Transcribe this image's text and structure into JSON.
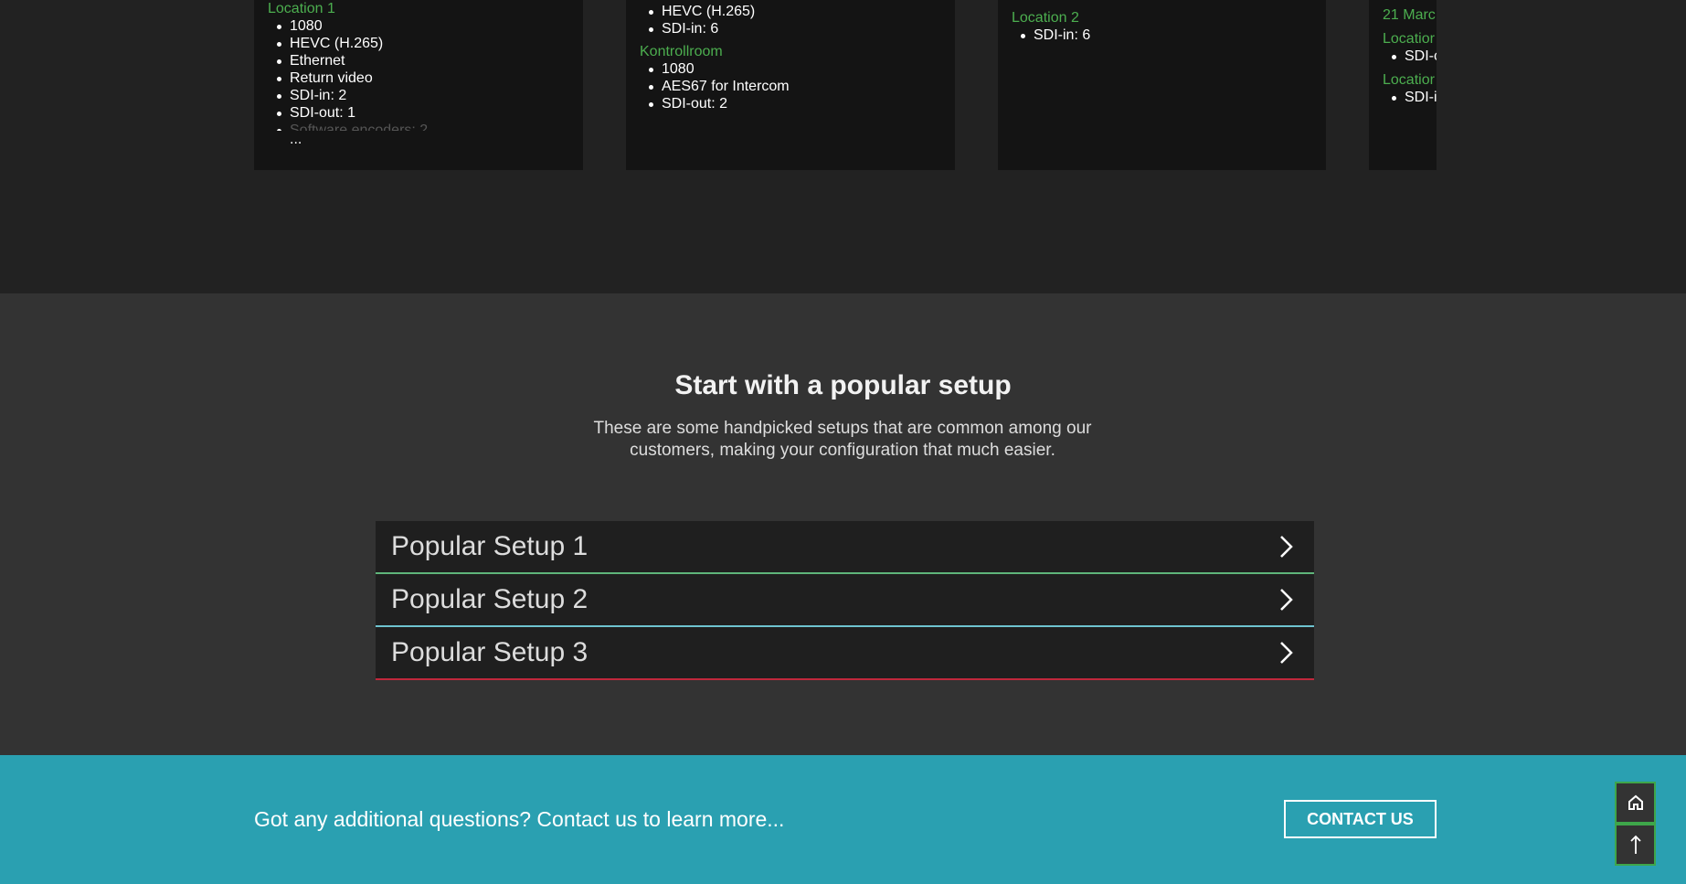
{
  "cards": [
    {
      "groups": [
        {
          "title": "Location 1",
          "items": [
            "1080",
            "HEVC (H.265)",
            "Ethernet",
            "Return video",
            "SDI-in: 2",
            "SDI-out: 1"
          ]
        }
      ],
      "faded": "Software encoders: 2",
      "more": "..."
    },
    {
      "groups": [
        {
          "title": "",
          "items": [
            "HEVC (H.265)",
            "SDI-in: 6"
          ]
        },
        {
          "title": "Kontrollroom",
          "items": [
            "1080",
            "AES67 for Intercom",
            "SDI-out: 2"
          ]
        }
      ]
    },
    {
      "groups": [
        {
          "title": "Location 2",
          "items": [
            "SDI-in: 6"
          ]
        }
      ]
    },
    {
      "date": "21 Marc",
      "groups": [
        {
          "title": "Locatior",
          "items": [
            "SDI-c"
          ]
        },
        {
          "title": "Locatior",
          "items": [
            "SDI-i"
          ]
        }
      ]
    }
  ],
  "popular": {
    "heading": "Start with a popular setup",
    "description": "These are some handpicked setups that are common among our customers, making your configuration that much easier.",
    "setups": [
      {
        "label": "Popular Setup 1",
        "color": "#5fb57a"
      },
      {
        "label": "Popular Setup 2",
        "color": "#6ec3cf"
      },
      {
        "label": "Popular Setup 3",
        "color": "#c0283c"
      }
    ]
  },
  "footer": {
    "question": "Got any additional questions? Contact us to learn more...",
    "contact_label": "CONTACT US"
  },
  "side_buttons": {
    "home": "home-icon",
    "top": "arrow-up-icon"
  }
}
